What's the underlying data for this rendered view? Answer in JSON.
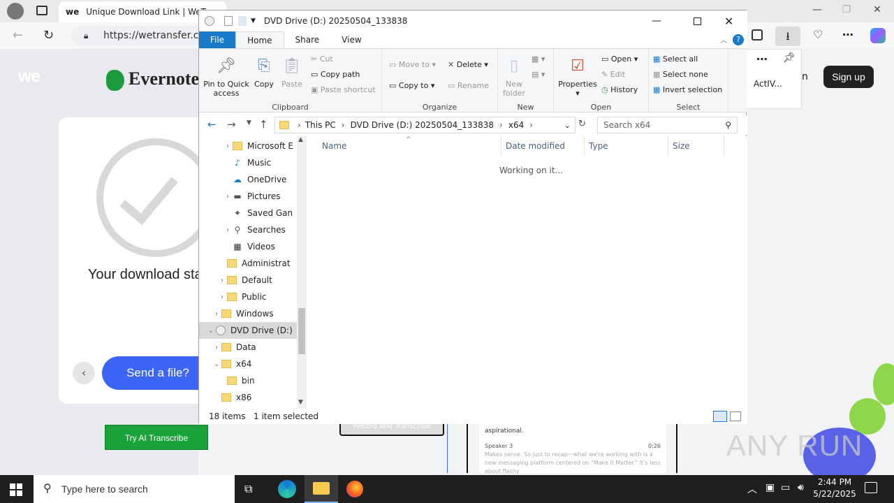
{
  "browser": {
    "tab_title": "Unique Download Link | WeTran",
    "url": "https://wetransfer.com",
    "window_controls": [
      "—",
      "❐",
      "✕"
    ]
  },
  "webpage": {
    "we_logo": "we",
    "evernote": "Evernote",
    "download_title": "Your download started",
    "send_button": "Send a file?",
    "ai_button": "Try AI Transcribe",
    "signup": "Sign up",
    "side_text": "ActIV...",
    "side_text_n": "n",
    "transcript": {
      "line1": "aspirational.",
      "speaker": "Speaker 3",
      "time": "0:26",
      "body": "Makes sense. So just to recap—what we're working with is a new messaging platform centered on \"Make it Matter.\" It's less about flashy"
    },
    "record_chip": "Record and Transcribe"
  },
  "explorer": {
    "title": "DVD Drive (D:) 20250504_133838",
    "tabs": [
      "File",
      "Home",
      "Share",
      "View"
    ],
    "ribbon": {
      "clipboard": {
        "label": "Clipboard",
        "pin": "Pin to Quick access",
        "copy": "Copy",
        "paste": "Paste",
        "cut": "Cut",
        "copy_path": "Copy path",
        "paste_shortcut": "Paste shortcut"
      },
      "organize": {
        "label": "Organize",
        "move_to": "Move to",
        "copy_to": "Copy to",
        "delete": "Delete",
        "rename": "Rename"
      },
      "new": {
        "label": "New",
        "new_folder": "New folder"
      },
      "open": {
        "label": "Open",
        "properties": "Properties",
        "open": "Open",
        "edit": "Edit",
        "history": "History"
      },
      "select": {
        "label": "Select",
        "select_all": "Select all",
        "select_none": "Select none",
        "invert": "Invert selection"
      }
    },
    "address": {
      "crumbs": [
        "This PC",
        "DVD Drive (D:) 20250504_133838",
        "x64"
      ]
    },
    "search_placeholder": "Search x64",
    "nav": [
      {
        "label": "Microsoft E"
      },
      {
        "label": "Music"
      },
      {
        "label": "OneDrive"
      },
      {
        "label": "Pictures"
      },
      {
        "label": "Saved Gan"
      },
      {
        "label": "Searches"
      },
      {
        "label": "Videos"
      },
      {
        "label": "Administrat"
      },
      {
        "label": "Default"
      },
      {
        "label": "Public"
      },
      {
        "label": "Windows"
      },
      {
        "label": "DVD Drive (D:)"
      },
      {
        "label": "Data"
      },
      {
        "label": "x64"
      },
      {
        "label": "bin"
      },
      {
        "label": "x86"
      }
    ],
    "columns": [
      "Name",
      "Date modified",
      "Type",
      "Size"
    ],
    "working_text": "Working on it...",
    "status_items": "18 items",
    "status_selected": "1 item selected"
  },
  "taskbar": {
    "search_placeholder": "Type here to search",
    "time": "2:44 PM",
    "date": "5/22/2025"
  },
  "watermark": "ANY RUN"
}
